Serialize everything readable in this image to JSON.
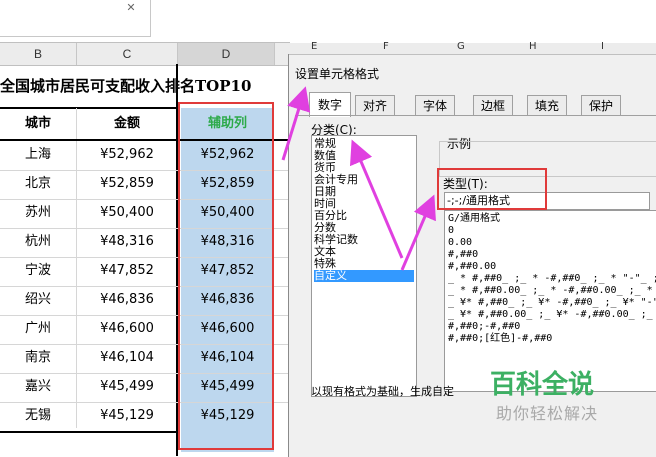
{
  "sheet": {
    "columns": [
      "B",
      "C",
      "D"
    ],
    "dialog_columns": [
      "E",
      "F",
      "G",
      "H",
      "I"
    ],
    "title": "全国城市居民可支配收入排名TOP10",
    "headers": {
      "city": "城市",
      "amount": "金额",
      "helper": "辅助列"
    },
    "rows": [
      {
        "city": "上海",
        "amount": "¥52,962",
        "helper": "¥52,962"
      },
      {
        "city": "北京",
        "amount": "¥52,859",
        "helper": "¥52,859"
      },
      {
        "city": "苏州",
        "amount": "¥50,400",
        "helper": "¥50,400"
      },
      {
        "city": "杭州",
        "amount": "¥48,316",
        "helper": "¥48,316"
      },
      {
        "city": "宁波",
        "amount": "¥47,852",
        "helper": "¥47,852"
      },
      {
        "city": "绍兴",
        "amount": "¥46,836",
        "helper": "¥46,836"
      },
      {
        "city": "广州",
        "amount": "¥46,600",
        "helper": "¥46,600"
      },
      {
        "city": "南京",
        "amount": "¥46,104",
        "helper": "¥46,104"
      },
      {
        "city": "嘉兴",
        "amount": "¥45,499",
        "helper": "¥45,499"
      },
      {
        "city": "无锡",
        "amount": "¥45,129",
        "helper": "¥45,129"
      }
    ]
  },
  "dialog": {
    "title": "设置单元格格式",
    "tabs": [
      "数字",
      "对齐",
      "字体",
      "边框",
      "填充",
      "保护"
    ],
    "category_label": "分类(C):",
    "categories": [
      "常规",
      "数值",
      "货币",
      "会计专用",
      "日期",
      "时间",
      "百分比",
      "分数",
      "科学记数",
      "文本",
      "特殊",
      "自定义"
    ],
    "selected_category": "自定义",
    "sample_label": "示例",
    "type_label": "类型(T):",
    "type_value": "-;-;/通用格式",
    "formats": [
      "G/通用格式",
      "0",
      "0.00",
      "#,##0",
      "#,##0.00",
      "_ * #,##0_ ;_ * -#,##0_ ;_ * \"-\"_ ;",
      "_ * #,##0.00_ ;_ * -#,##0.00_ ;_ * \"-",
      "_ ¥* #,##0_ ;_ ¥* -#,##0_ ;_ ¥* \"-\"_",
      "_ ¥* #,##0.00_ ;_ ¥* -#,##0.00_ ;_ ¥",
      "#,##0;-#,##0",
      "#,##0;[红色]-#,##0"
    ],
    "hint": "以现有格式为基础，生成自定"
  },
  "watermark": {
    "main": "百科全说",
    "sub": "助你轻松解决"
  },
  "colors": {
    "accent": "#e03a3a",
    "arrow": "#e040e0",
    "helper_fill": "#bdd7ee",
    "header_green": "#2daa4a",
    "watermark": "#3cb063"
  }
}
